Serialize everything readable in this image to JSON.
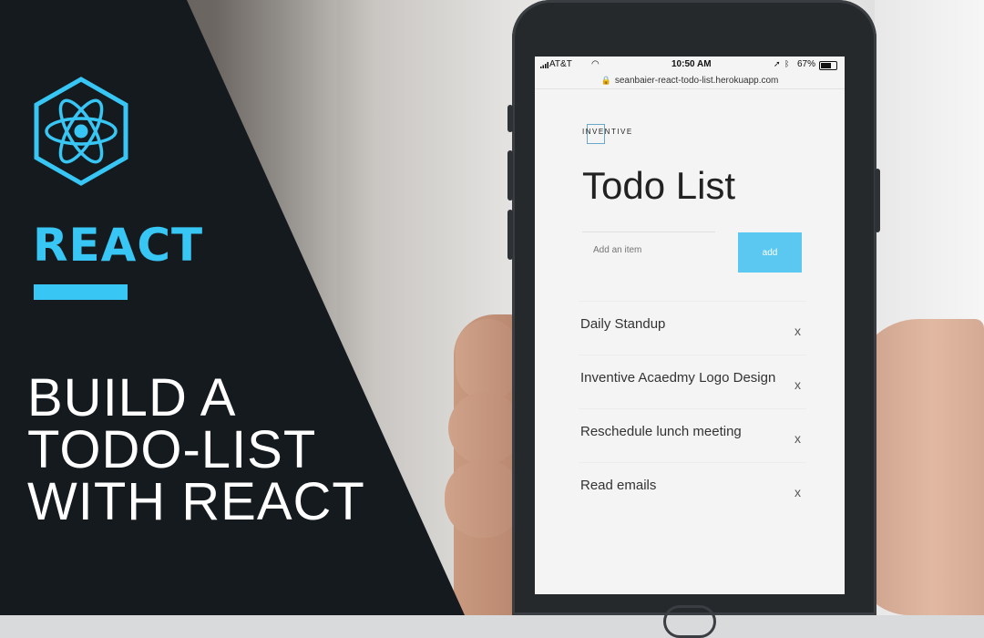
{
  "banner": {
    "logo_icon": "react-atom-icon",
    "react_label": "REACT",
    "headline_lines": [
      "BUILD A",
      "TODO-LIST",
      "WITH REACT"
    ],
    "accent_color": "#38c6f4"
  },
  "status_bar": {
    "carrier": "AT&T",
    "time": "10:50 AM",
    "battery": "67%"
  },
  "browser": {
    "url": "seanbaier-react-todo-list.herokuapp.com"
  },
  "app": {
    "brand": "INVENTIVE",
    "title": "Todo List",
    "input_placeholder": "Add an item",
    "add_label": "add",
    "items": [
      {
        "text": "Daily Standup",
        "remove": "x"
      },
      {
        "text": "Inventive Acaedmy Logo Design",
        "remove": "x"
      },
      {
        "text": "Reschedule lunch meeting",
        "remove": "x"
      },
      {
        "text": "Read emails",
        "remove": "x"
      }
    ]
  }
}
